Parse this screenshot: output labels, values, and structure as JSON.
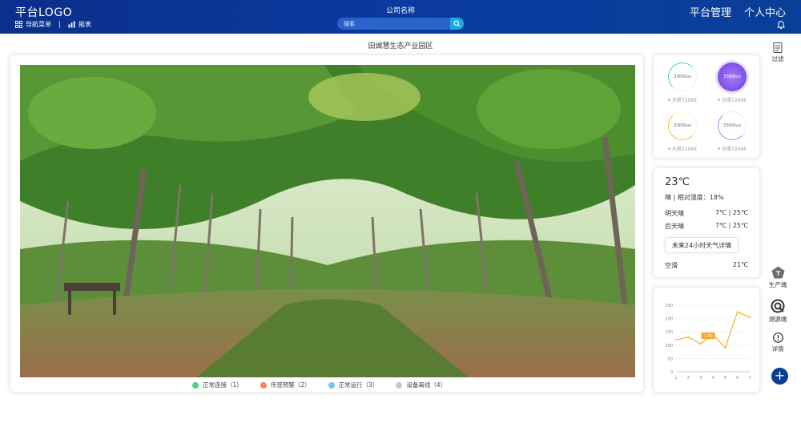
{
  "header": {
    "logo": "平台LOGO",
    "company": "公司名称",
    "nav_menu": "导航菜单",
    "report": "报表",
    "search_placeholder": "搜索",
    "platform_manage": "平台管理",
    "personal_center": "个人中心"
  },
  "park_title": "田诚慧生态产业园区",
  "legend": [
    {
      "label": "正常连接（1）",
      "color": "#4cd28b"
    },
    {
      "label": "传感预警（2）",
      "color": "#f08a5d"
    },
    {
      "label": "正常运行（3）",
      "color": "#7cc0f0"
    },
    {
      "label": "设备离线（4）",
      "color": "#c8c8c8"
    }
  ],
  "sensors": [
    {
      "value": "3300lux",
      "caption": "光照7206E",
      "color": "#4cd2b6",
      "active": false
    },
    {
      "value": "3300lux",
      "caption": "光照7206E",
      "color": "#8a5cf0",
      "active": true
    },
    {
      "value": "3300lux",
      "caption": "光照7206E",
      "color": "#f2c12e",
      "active": false
    },
    {
      "value": "3300lux",
      "caption": "光照7206E",
      "color": "#b27cf0",
      "active": false
    }
  ],
  "weather": {
    "temp": "23℃",
    "condition": "晴 | 相对湿度：18%",
    "rows": [
      {
        "day": "明天晴",
        "range": "7℃ | 25℃"
      },
      {
        "day": "后天晴",
        "range": "7℃ | 25℃"
      }
    ],
    "forecast_button": "未来24小时天气详情",
    "ac_label": "空滑",
    "ac_value": "21℃"
  },
  "rail": {
    "filter": "过滤",
    "production": "生产端",
    "trace": "溯源端",
    "detail": "详情"
  },
  "chart_data": {
    "type": "line",
    "x": [
      1,
      2,
      3,
      4,
      5,
      6,
      7
    ],
    "values": [
      120,
      130,
      105,
      140,
      90,
      225,
      205
    ],
    "ylim": [
      0,
      250
    ],
    "yticks": [
      0,
      50,
      100,
      150,
      200,
      250
    ],
    "tooltip": "1.00",
    "color": "#f2b21d"
  }
}
